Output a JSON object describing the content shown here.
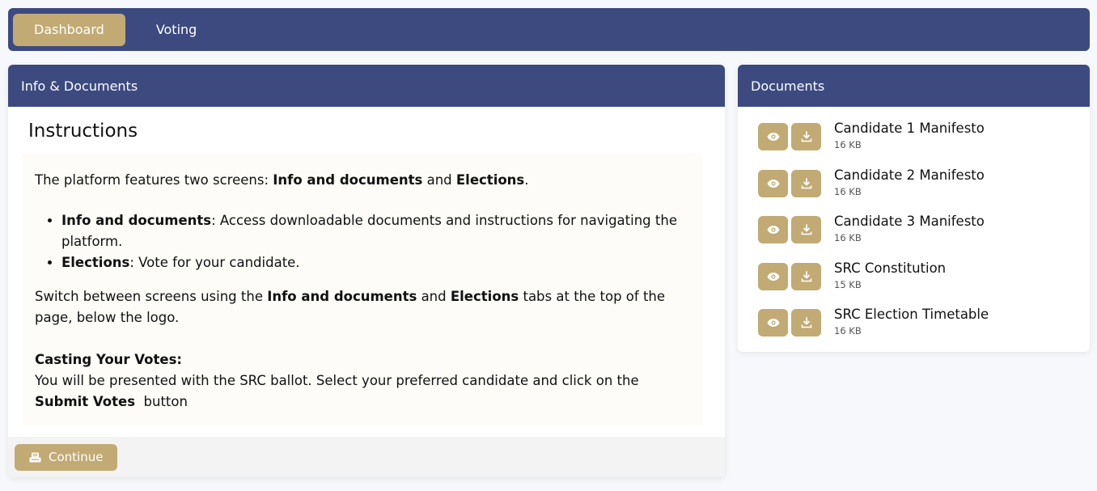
{
  "nav": {
    "tabs": [
      {
        "label": "Dashboard",
        "active": true
      },
      {
        "label": "Voting",
        "active": false
      }
    ]
  },
  "info": {
    "header": "Info & Documents",
    "title": "Instructions",
    "intro": {
      "prefix": "The platform features two screens: ",
      "bold1": "Info and documents",
      "middle": " and ",
      "bold2": "Elections",
      "suffix": "."
    },
    "bullets": [
      {
        "bold": "Info and documents",
        "text": ": Access downloadable documents and instructions for navigating the platform."
      },
      {
        "bold": "Elections",
        "text": ": Vote for your candidate."
      }
    ],
    "switch": {
      "prefix": "Switch between screens using the ",
      "bold1": "Info and documents",
      "middle": " and ",
      "bold2": "Elections",
      "suffix": " tabs at the top of the page, below the logo."
    },
    "casting": {
      "heading": "Casting Your Votes:",
      "text": "You will be presented with the SRC ballot. Select your preferred candidate and click on the ",
      "bold": "Submit Votes",
      "suffix": "  button"
    },
    "continue_label": "Continue"
  },
  "documents": {
    "header": "Documents",
    "items": [
      {
        "name": "Candidate 1 Manifesto",
        "size": "16 KB"
      },
      {
        "name": "Candidate 2 Manifesto",
        "size": "16 KB"
      },
      {
        "name": "Candidate 3 Manifesto",
        "size": "16 KB"
      },
      {
        "name": "SRC Constitution",
        "size": "15 KB"
      },
      {
        "name": "SRC Election Timetable",
        "size": "16 KB"
      }
    ]
  },
  "colors": {
    "nav_bg": "#3c4a80",
    "accent_gold": "#c2aa74"
  },
  "icons": {
    "view": "eye-icon",
    "download": "download-icon",
    "continue": "ballot-icon"
  }
}
